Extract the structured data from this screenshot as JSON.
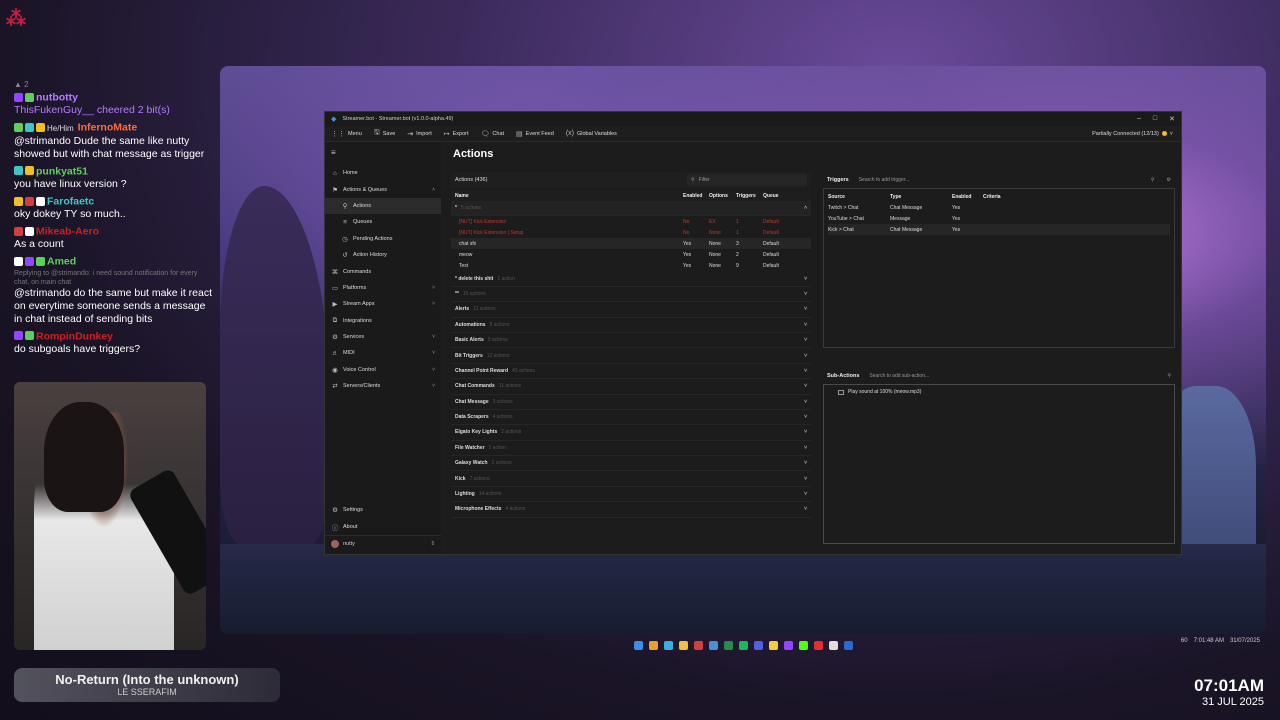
{
  "corner_logo": "⁂",
  "chat": {
    "top_count": "2",
    "messages": [
      {
        "name": "nutbotty",
        "color": "#b57cff",
        "text": "ThisFukenGuy__ cheered 2 bit(s)",
        "text_color": "#b57cff"
      },
      {
        "pronoun": "He/Him",
        "name": "InfernoMate",
        "color": "#ff6b3d",
        "text": "@strimando Dude the same like nutty showed but with chat message as trigger"
      },
      {
        "name": "punkyat51",
        "color": "#5dcf5d",
        "text": "you have linux version ?"
      },
      {
        "name": "Farofaetc",
        "color": "#3ec5c5",
        "text": "oky dokey TY so much.."
      },
      {
        "name": "Mikeab-Aero",
        "color": "#cc2020",
        "text": "As a count"
      },
      {
        "name": "Amed",
        "color": "#5dcf5d",
        "reply": "Replying to @strimando: i need sound notification for every chat, on main chat",
        "text": "@strimando do the same but make it react on everytime someone sends a message in chat instead of sending bits"
      },
      {
        "name": "RompinDunkey",
        "color": "#d02020",
        "text": "do subgoals have triggers?"
      }
    ]
  },
  "now_playing": {
    "title": "No-Return (Into the unknown)",
    "artist": "LE SSERAFIM"
  },
  "clock": {
    "time": "07:01AM",
    "date": "31 JUL 2025"
  },
  "tray": {
    "volume": "60",
    "time": "7:01:48 AM",
    "date": "31/07/2025"
  },
  "window": {
    "title": "Streamer.bot - Streamer.bot (v1.0.0-alpha.49)",
    "controls": [
      "–",
      "□",
      "✕"
    ],
    "toolbar": [
      {
        "icon": "⋮⋮",
        "label": "Menu",
        "name": "menu"
      },
      {
        "icon": "🖫",
        "label": "Save",
        "name": "save"
      },
      {
        "icon": "⇥",
        "label": "Import",
        "name": "import"
      },
      {
        "icon": "↦",
        "label": "Export",
        "name": "export"
      },
      {
        "icon": "🗨",
        "label": "Chat",
        "name": "chat"
      },
      {
        "icon": "▤",
        "label": "Event Feed",
        "name": "event-feed"
      },
      {
        "icon": "(x)",
        "label": "Global Variables",
        "name": "global-variables"
      }
    ],
    "connection": "Partially Connected (12/13)",
    "sidebar": {
      "items": [
        {
          "icon": "⌂",
          "label": "Home",
          "name": "home"
        },
        {
          "icon": "⚑",
          "label": "Actions & Queues",
          "name": "actions-queues",
          "chev": "˄",
          "active": true
        },
        {
          "icon": "⚲",
          "label": "Actions",
          "name": "actions",
          "sub": true,
          "active": true
        },
        {
          "icon": "≡",
          "label": "Queues",
          "name": "queues",
          "sub": true
        },
        {
          "icon": "◷",
          "label": "Pending Actions",
          "name": "pending-actions",
          "sub": true
        },
        {
          "icon": "↺",
          "label": "Action History",
          "name": "action-history",
          "sub": true
        },
        {
          "icon": "⌘",
          "label": "Commands",
          "name": "commands"
        },
        {
          "icon": "▭",
          "label": "Platforms",
          "name": "platforms",
          "chev": "˅"
        },
        {
          "icon": "▶",
          "label": "Stream Apps",
          "name": "stream-apps",
          "chev": "˅"
        },
        {
          "icon": "⧉",
          "label": "Integrations",
          "name": "integrations"
        },
        {
          "icon": "⚙",
          "label": "Services",
          "name": "services",
          "chev": "˅"
        },
        {
          "icon": "♬",
          "label": "MIDI",
          "name": "midi",
          "chev": "˅"
        },
        {
          "icon": "◉",
          "label": "Voice Control",
          "name": "voice-control",
          "chev": "˅"
        },
        {
          "icon": "⇄",
          "label": "Servers/Clients",
          "name": "servers-clients",
          "chev": "˅"
        }
      ],
      "bottom": [
        {
          "icon": "⚙",
          "label": "Settings",
          "name": "settings"
        },
        {
          "icon": "ⓘ",
          "label": "About",
          "name": "about"
        }
      ],
      "user": "nutty"
    },
    "page_title": "Actions",
    "actions_panel": {
      "label": "Actions (436)",
      "filter_placeholder": "Filter",
      "columns": {
        "name": "Name",
        "enabled": "Enabled",
        "options": "Options",
        "triggers": "Triggers",
        "queue": "Queue"
      },
      "open_group": {
        "label": "*",
        "count": "5 actions"
      },
      "rows": [
        {
          "name": "[NUT] Kick Extension",
          "enabled": "No",
          "options": "EX",
          "triggers": "1",
          "queue": "Default",
          "disabled": true
        },
        {
          "name": "[NUT] Kick Extension | Setup",
          "enabled": "No",
          "options": "None",
          "triggers": "1",
          "queue": "Default",
          "disabled": true
        },
        {
          "name": "chat sfx",
          "enabled": "Yes",
          "options": "None",
          "triggers": "3",
          "queue": "Default",
          "sel": true
        },
        {
          "name": "meow",
          "enabled": "Yes",
          "options": "None",
          "triggers": "2",
          "queue": "Default"
        },
        {
          "name": "Test",
          "enabled": "Yes",
          "options": "None",
          "triggers": "9",
          "queue": "Default"
        }
      ],
      "groups": [
        {
          "label": "* delete this shit",
          "count": "1 action"
        },
        {
          "label": "**",
          "count": "15 actions"
        },
        {
          "label": "Alerts",
          "count": "11 actions"
        },
        {
          "label": "Automations",
          "count": "5 actions"
        },
        {
          "label": "Basic Alerts",
          "count": "9 actions"
        },
        {
          "label": "Bit Triggers",
          "count": "12 actions"
        },
        {
          "label": "Channel Point Reward",
          "count": "41 actions"
        },
        {
          "label": "Chat Commands",
          "count": "11 actions"
        },
        {
          "label": "Chat Message",
          "count": "3 actions"
        },
        {
          "label": "Data Scrapers",
          "count": "4 actions"
        },
        {
          "label": "Elgato Key Lights",
          "count": "2 actions"
        },
        {
          "label": "File Watcher",
          "count": "1 action"
        },
        {
          "label": "Galaxy Watch",
          "count": "2 actions"
        },
        {
          "label": "Kick",
          "count": "7 actions"
        },
        {
          "label": "Lighting",
          "count": "14 actions"
        },
        {
          "label": "Microphone Effects",
          "count": "4 actions"
        }
      ]
    },
    "triggers_panel": {
      "label": "Triggers",
      "search_placeholder": "Search to add trigger...",
      "columns": {
        "source": "Source",
        "type": "Type",
        "enabled": "Enabled",
        "criteria": "Criteria"
      },
      "rows": [
        {
          "source": "Twitch > Chat",
          "type": "Chat Message",
          "enabled": "Yes",
          "criteria": ""
        },
        {
          "source": "YouTube > Chat",
          "type": "Message",
          "enabled": "Yes",
          "criteria": ""
        },
        {
          "source": "Kick > Chat",
          "type": "Chat Message",
          "enabled": "Yes",
          "criteria": "",
          "sel": true
        }
      ]
    },
    "subactions_panel": {
      "label": "Sub-Actions",
      "search_placeholder": "Search to add sub-action...",
      "items": [
        "Play sound at 100% (meow.mp3)"
      ]
    }
  },
  "colors": {
    "disabled_text": "#c0392b",
    "connection_dot": "#f0c020",
    "accent": "#4a8fd8"
  }
}
